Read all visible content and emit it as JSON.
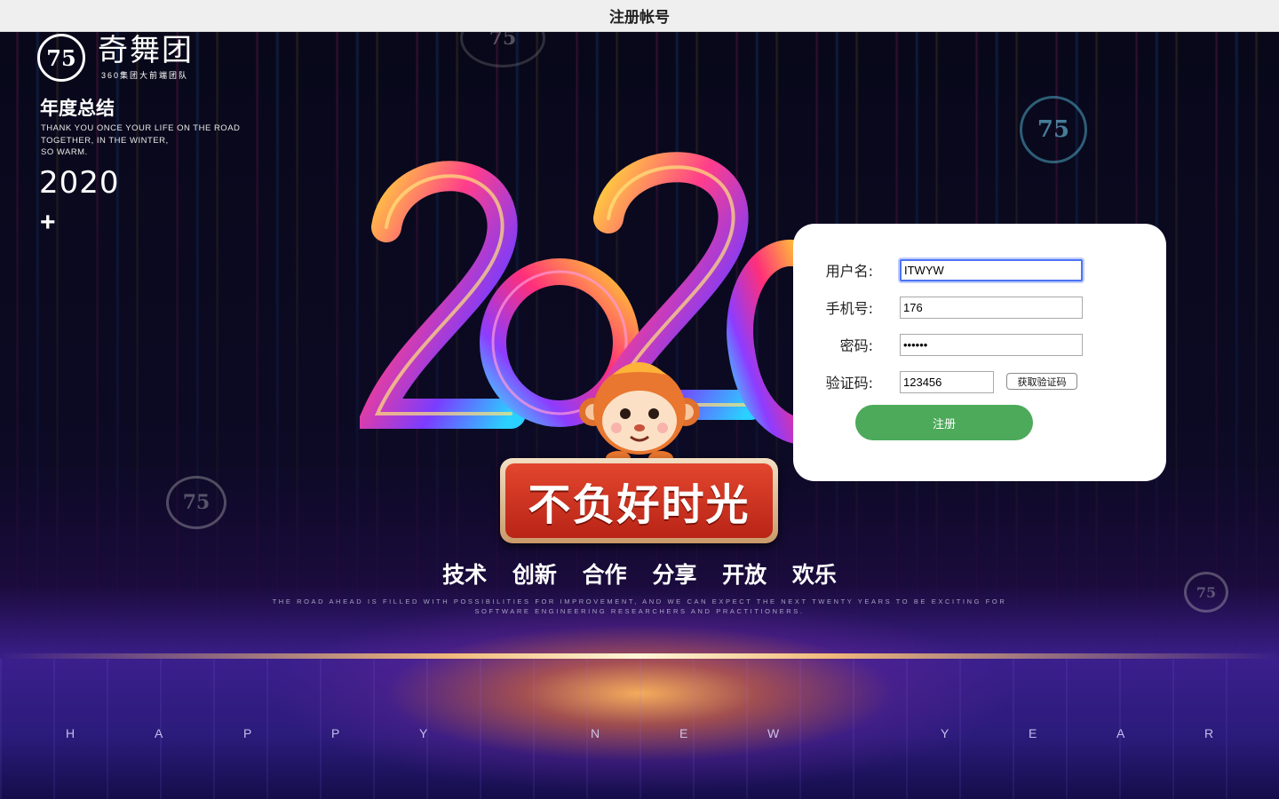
{
  "window": {
    "title": "注册帐号"
  },
  "poster": {
    "logo_mark": "75",
    "logo_name": "奇舞团",
    "logo_subtitle": "360集团大前端团队",
    "annual_title": "年度总结",
    "thanks_lines": [
      "THANK YOU ONCE YOUR LIFE ON THE ROAD",
      "TOGETHER, IN THE WINTER,",
      "SO WARM."
    ],
    "year": "2020",
    "plus": "+",
    "slogan": "不负好时光",
    "values": [
      "技术",
      "创新",
      "合作",
      "分享",
      "开放",
      "欢乐"
    ],
    "road_lines": [
      "THE ROAD AHEAD IS FILLED WITH POSSIBILITIES FOR IMPROVEMENT, AND WE CAN EXPECT THE NEXT TWENTY YEARS TO BE EXCITING FOR",
      "SOFTWARE ENGINEERING RESEARCHERS AND PRACTITIONERS."
    ],
    "happy_letters": [
      "H",
      "A",
      "P",
      "P",
      "Y",
      "N",
      "E",
      "W",
      "Y",
      "E",
      "A",
      "R"
    ],
    "coin_mark": "75"
  },
  "form": {
    "username": {
      "label": "用户名:",
      "value": "ITWYW"
    },
    "phone": {
      "label": "手机号:",
      "value": "176"
    },
    "password": {
      "label": "密码:",
      "value": "••••••"
    },
    "code": {
      "label": "验证码:",
      "value": "123456",
      "button_label": "获取验证码"
    },
    "submit_label": "注册"
  },
  "colors": {
    "submit_bg": "#4caa5a",
    "focus_ring": "#4c73f5",
    "card_bg": "#ffffff",
    "titlebar_bg": "#efefef"
  }
}
